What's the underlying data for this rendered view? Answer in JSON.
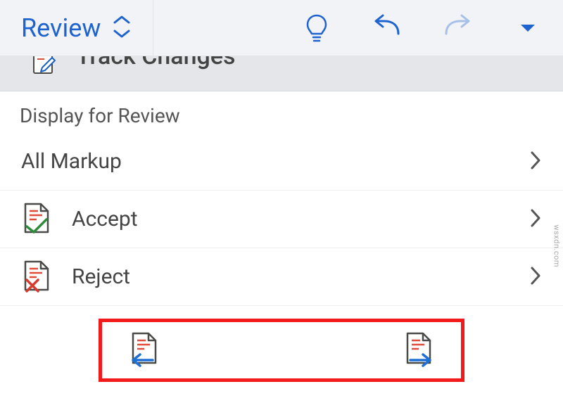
{
  "header": {
    "tab_label": "Review"
  },
  "panel": {
    "track_changes_label": "Track Changes",
    "display_for_review_label": "Display for Review",
    "markup_mode": "All Markup",
    "accept_label": "Accept",
    "reject_label": "Reject"
  },
  "watermark": "wsxdn.com"
}
